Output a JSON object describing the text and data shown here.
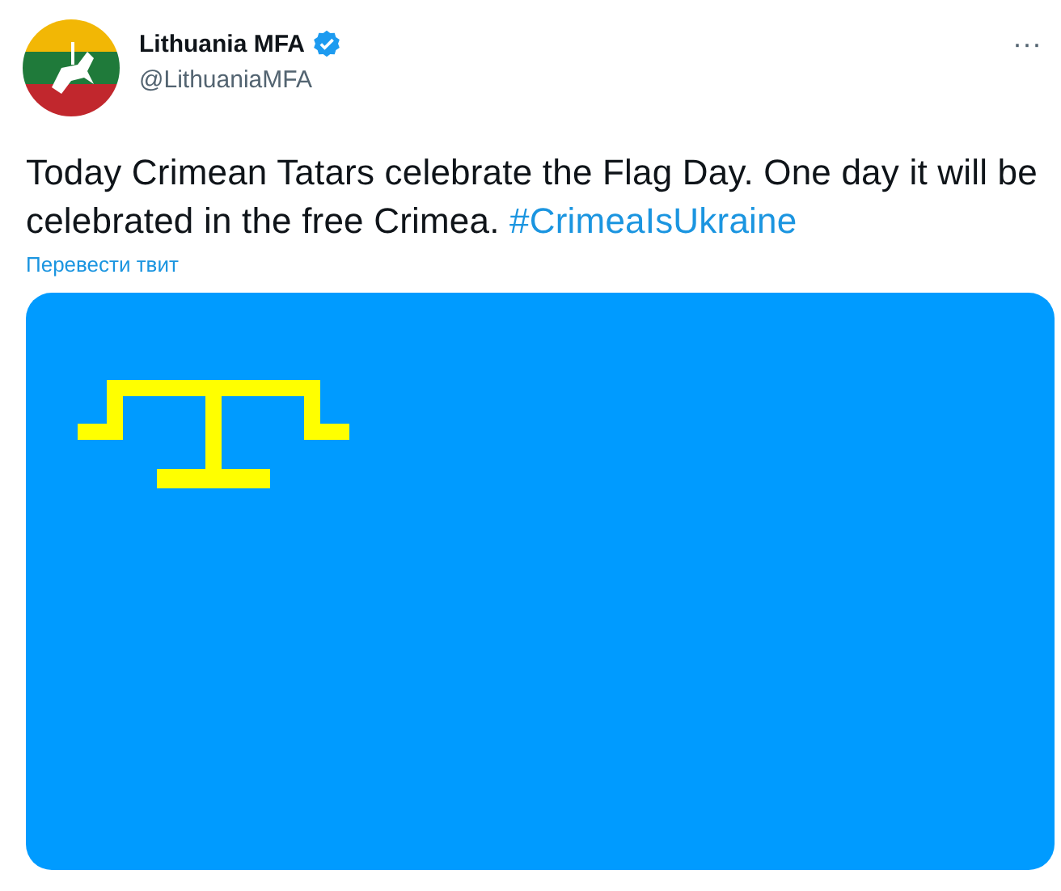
{
  "author": {
    "name": "Lithuania MFA",
    "verified": true,
    "handle": "@LithuaniaMFA"
  },
  "more": "···",
  "tweet": {
    "text": "Today Crimean Tatars celebrate the Flag Day. One day it will be celebrated in the free Crimea.",
    "hashtag": "#CrimeaIsUkraine",
    "translate": "Перевести твит"
  },
  "media": {
    "kind": "flag"
  }
}
